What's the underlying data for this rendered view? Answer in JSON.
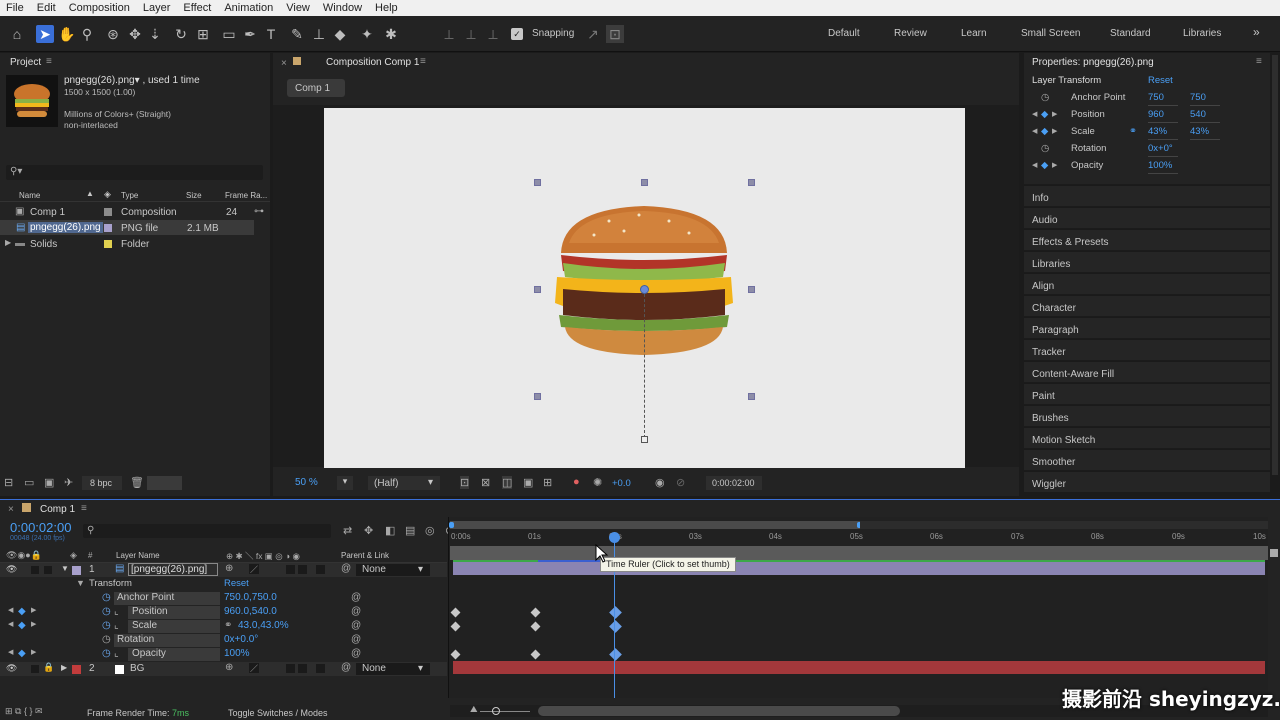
{
  "menu": [
    "File",
    "Edit",
    "Composition",
    "Layer",
    "Effect",
    "Animation",
    "View",
    "Window",
    "Help"
  ],
  "toolbar": {
    "snapping_label": "Snapping",
    "workspaces": [
      "Default",
      "Review",
      "Learn",
      "Small Screen",
      "Standard",
      "Libraries"
    ],
    "more": "»"
  },
  "project": {
    "title": "Project",
    "asset_name": "pngegg(26).png",
    "asset_used": ", used 1 time",
    "asset_dims": "1500 x 1500 (1.00)",
    "asset_colors": "Millions of Colors+ (Straight)",
    "asset_interlace": "non-interlaced",
    "search_placeholder": "",
    "columns": {
      "name": "Name",
      "type": "Type",
      "size": "Size",
      "frame_rate": "Frame Ra..."
    },
    "items": [
      {
        "name": "Comp 1",
        "type": "Composition",
        "size": "",
        "fps": "24"
      },
      {
        "name": "pngegg(26).png",
        "type": "PNG file",
        "size": "2.1 MB",
        "fps": ""
      },
      {
        "name": "Solids",
        "type": "Folder",
        "size": "",
        "fps": ""
      }
    ],
    "bpc": "8 bpc"
  },
  "composition": {
    "tab": "Composition Comp 1",
    "sub_tab": "Comp 1",
    "zoom": "50",
    "zoom_unit": "%",
    "resolution": "(Half)",
    "exposure": "+0.0",
    "timecode": "0:00:02:00"
  },
  "properties": {
    "title": "Properties: pngegg(26).png",
    "section": "Layer Transform",
    "reset": "Reset",
    "rows": [
      {
        "label": "Anchor Point",
        "v1": "750",
        "v2": "750"
      },
      {
        "label": "Position",
        "v1": "960",
        "v2": "540"
      },
      {
        "label": "Scale",
        "v1": "43%",
        "v2": "43%"
      },
      {
        "label": "Rotation",
        "v1": "0x+0°",
        "v2": ""
      },
      {
        "label": "Opacity",
        "v1": "100%",
        "v2": ""
      }
    ],
    "panels": [
      "Info",
      "Audio",
      "Effects & Presets",
      "Libraries",
      "Align",
      "Character",
      "Paragraph",
      "Tracker",
      "Content-Aware Fill",
      "Paint",
      "Brushes",
      "Motion Sketch",
      "Smoother",
      "Wiggler"
    ]
  },
  "timeline": {
    "tab": "Comp 1",
    "timecode": "0:00:02:00",
    "fps_info": "00048 (24.00 fps)",
    "col_layer_name": "Layer Name",
    "col_parent": "Parent & Link",
    "ruler_ticks": [
      "0:00s",
      "01s",
      "02s",
      "03s",
      "04s",
      "05s",
      "06s",
      "07s",
      "08s",
      "09s",
      "10s"
    ],
    "tooltip": "Time Ruler (Click to set thumb)",
    "layers": [
      {
        "num": "1",
        "name": "[pngegg(26).png]",
        "parent": "None"
      },
      {
        "num": "2",
        "name": "BG",
        "parent": "None"
      }
    ],
    "transform_label": "Transform",
    "transform_reset": "Reset",
    "props": [
      {
        "label": "Anchor Point",
        "value": "750.0,750.0"
      },
      {
        "label": "Position",
        "value": "960.0,540.0"
      },
      {
        "label": "Scale",
        "value": "43.0,43.0%"
      },
      {
        "label": "Rotation",
        "value": "0x+0.0°"
      },
      {
        "label": "Opacity",
        "value": "100%"
      }
    ],
    "footer_render_label": "Frame Render Time:",
    "footer_render_value": "7ms",
    "footer_toggle": "Toggle Switches / Modes"
  },
  "watermark": "摄影前沿 sheyingzyz.com",
  "colors": {
    "accent": "#4a9ff5",
    "selection": "#3a6fd8",
    "bg_layer": "#a3383b",
    "label_purple": "#8c8cd0"
  }
}
